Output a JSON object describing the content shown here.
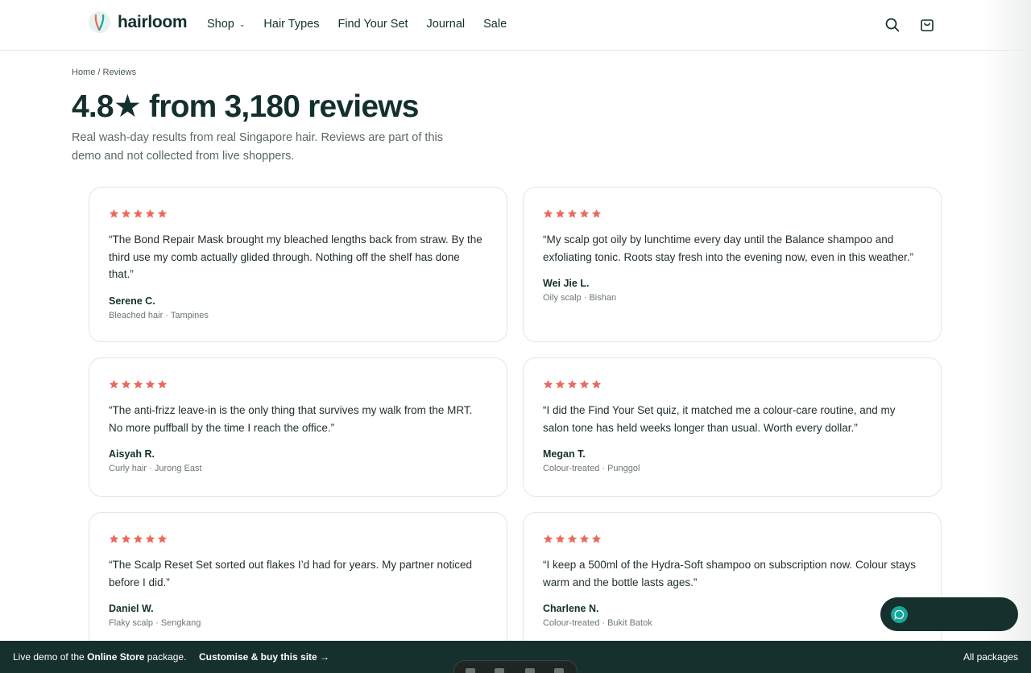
{
  "brand": {
    "name": "hairloom"
  },
  "nav": {
    "items": [
      {
        "label": "Shop",
        "dropdown": true
      },
      {
        "label": "Hair Types"
      },
      {
        "label": "Find Your Set"
      },
      {
        "label": "Journal"
      },
      {
        "label": "Sale"
      }
    ],
    "icons": [
      "search-icon",
      "cart-icon"
    ]
  },
  "breadcrumb": "Home / Reviews",
  "title": "4.8★ from 3,180 reviews",
  "subtitle": "Real wash-day results from real Singapore hair. Reviews are part of this demo and not collected from live shoppers.",
  "colors": {
    "star": "#ea6b5e",
    "dark": "#15302d",
    "accent": "#15a89a"
  },
  "reviews": [
    {
      "rating": 5,
      "quote": "“The Bond Repair Mask brought my bleached lengths back from straw. By the third use my comb actually glided through. Nothing off the shelf has done that.”",
      "name": "Serene C.",
      "meta": "Bleached hair · Tampines"
    },
    {
      "rating": 5,
      "quote": "“My scalp got oily by lunchtime every day until the Balance shampoo and exfoliating tonic. Roots stay fresh into the evening now, even in this weather.”",
      "name": "Wei Jie L.",
      "meta": "Oily scalp · Bishan"
    },
    {
      "rating": 5,
      "quote": "“The anti-frizz leave-in is the only thing that survives my walk from the MRT. No more puffball by the time I reach the office.”",
      "name": "Aisyah R.",
      "meta": "Curly hair · Jurong East"
    },
    {
      "rating": 5,
      "quote": "“I did the Find Your Set quiz, it matched me a colour-care routine, and my salon tone has held weeks longer than usual. Worth every dollar.”",
      "name": "Megan T.",
      "meta": "Colour-treated · Punggol"
    },
    {
      "rating": 5,
      "quote": "“The Scalp Reset Set sorted out flakes I’d had for years. My partner noticed before I did.”",
      "name": "Daniel W.",
      "meta": "Flaky scalp · Sengkang"
    },
    {
      "rating": 5,
      "quote": "“I keep a 500ml of the Hydra-Soft shampoo on subscription now. Colour stays warm and the bottle lasts ages.”",
      "name": "Charlene N.",
      "meta": "Colour-treated · Bukit Batok"
    }
  ],
  "demo_bar": {
    "text_prefix": "Live demo of the ",
    "text_bold": "Online Store",
    "text_suffix": " package.",
    "link": "Customise & buy this site →",
    "all": "All packages"
  }
}
